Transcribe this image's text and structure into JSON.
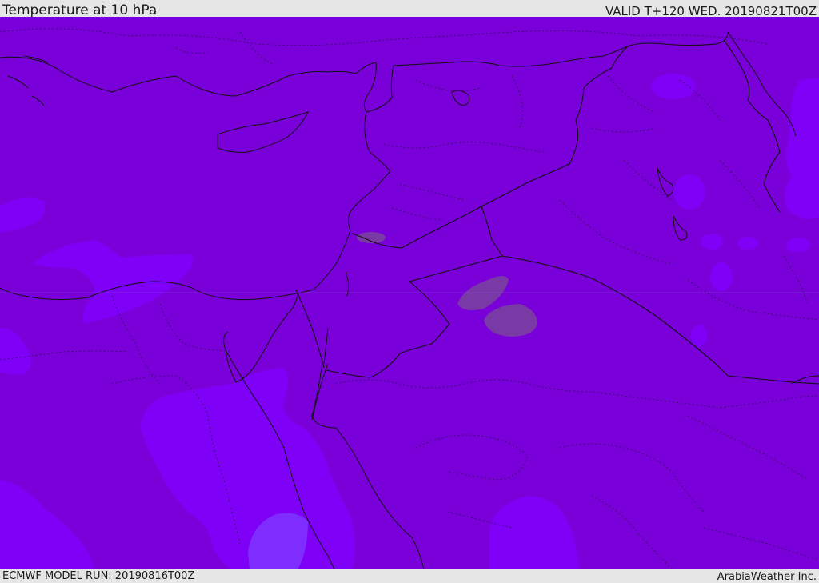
{
  "header": {
    "title": "Temperature at 10 hPa",
    "valid": "VALID T+120 WED. 20190821T00Z"
  },
  "footer": {
    "model_run": "ECMWF MODEL RUN: 20190816T00Z",
    "credit": "ArabiaWeather Inc."
  },
  "map": {
    "field": "temperature-10hpa",
    "colors": {
      "base_fill": "#7a00da",
      "light_fill": "#7e00f6",
      "lighter_fill": "#7f2cff",
      "warm_patch": "#7a3aa6",
      "border_line": "#111111",
      "admin_line": "#2a1050"
    }
  }
}
